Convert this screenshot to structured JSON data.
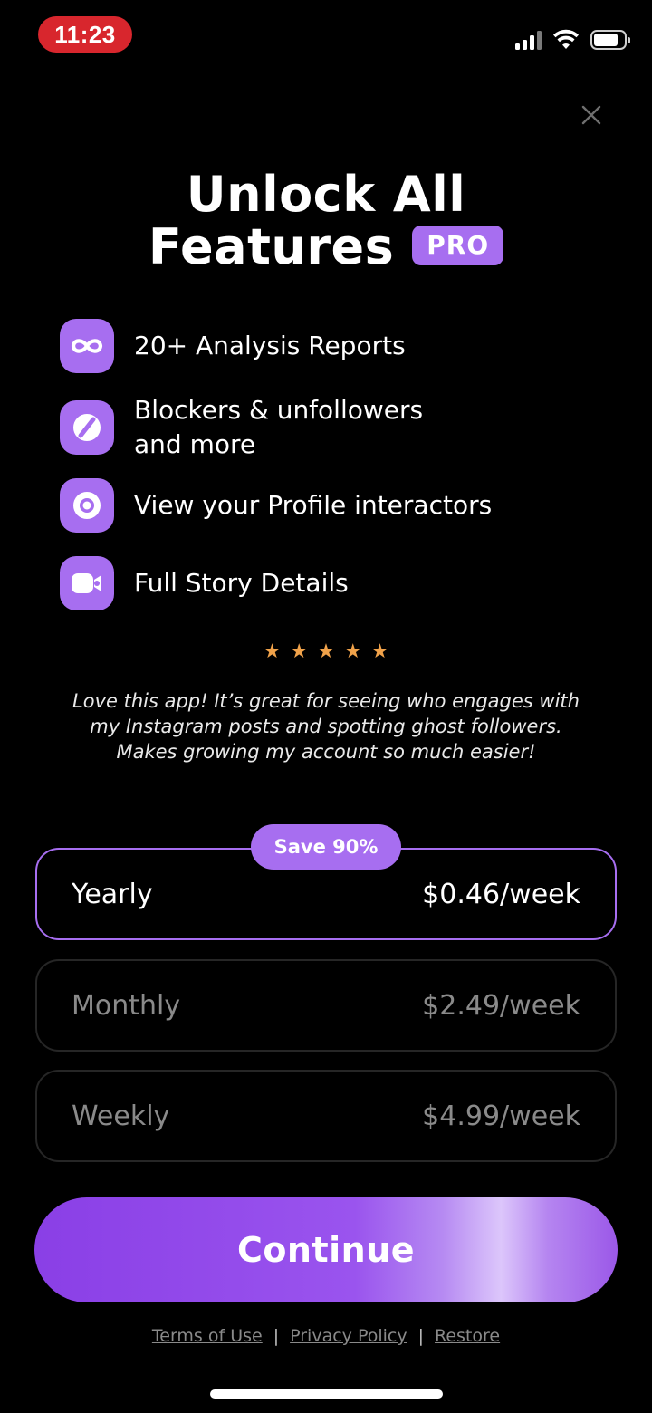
{
  "status_bar": {
    "time": "11:23",
    "signal_icon": "cellular-signal-icon",
    "wifi_icon": "wifi-icon",
    "battery_icon": "battery-icon"
  },
  "close_icon": "close-icon",
  "header": {
    "title_line1": "Unlock All",
    "title_line2": "Features",
    "badge": "PRO"
  },
  "features": [
    {
      "icon": "infinity-icon",
      "text": "20+ Analysis Reports"
    },
    {
      "icon": "block-icon",
      "text": "Blockers & unfollowers",
      "text2": "and more"
    },
    {
      "icon": "eye-icon",
      "text": "View your Profile interactors"
    },
    {
      "icon": "video-camera-icon",
      "text": "Full Story Details"
    }
  ],
  "rating": {
    "stars": 5
  },
  "review": "Love this app! It’s great for seeing who engages with my Instagram posts and spotting ghost followers. Makes growing my account so much easier!",
  "plans": [
    {
      "name": "Yearly",
      "price": "$0.46/week",
      "badge": "Save 90%",
      "selected": true
    },
    {
      "name": "Monthly",
      "price": "$2.49/week",
      "selected": false
    },
    {
      "name": "Weekly",
      "price": "$4.99/week",
      "selected": false
    }
  ],
  "cta": {
    "label": "Continue"
  },
  "footer": {
    "terms": "Terms of Use",
    "privacy": "Privacy Policy",
    "restore": "Restore",
    "separator": "|"
  },
  "colors": {
    "background": "#000000",
    "accent": "#a76ef0",
    "status_time_bg": "#d8262d",
    "star": "#f0a24a"
  }
}
